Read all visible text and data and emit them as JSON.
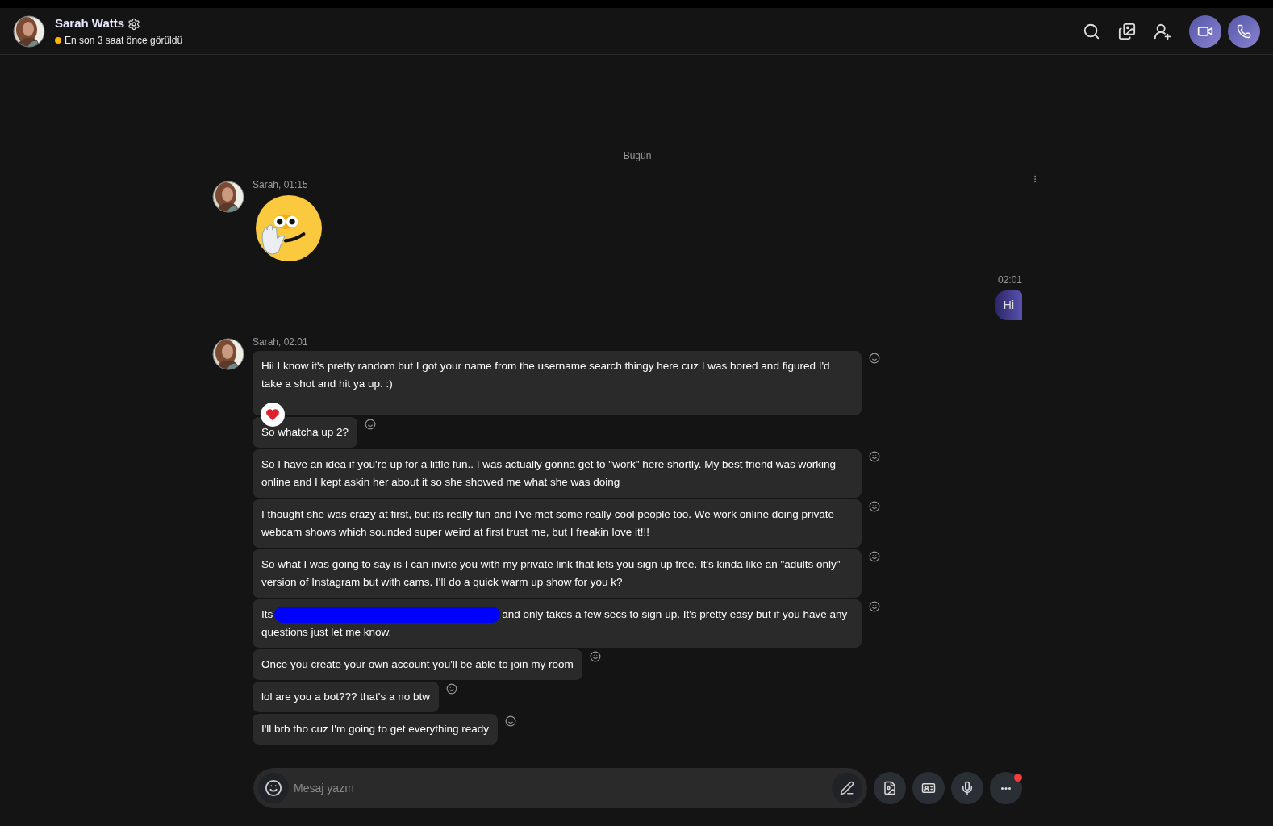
{
  "contact": {
    "name": "Sarah Watts",
    "status": "En son 3 saat önce görüldü"
  },
  "date_divider": "Bugün",
  "groups": [
    {
      "kind": "incoming",
      "header": "Sarah, 01:15",
      "items": [
        {
          "kind": "emoji"
        }
      ]
    },
    {
      "kind": "outgoing",
      "header": "02:01",
      "items": [
        {
          "kind": "text",
          "text": "Hi"
        }
      ]
    },
    {
      "kind": "incoming",
      "header": "Sarah, 02:01",
      "items": [
        {
          "kind": "text",
          "text": "Hii I know it's pretty random but I got your name from the username search thingy here cuz I was bored and figured I'd take a shot and hit ya up. :)",
          "heart": true
        },
        {
          "kind": "text",
          "text": "So whatcha up 2?",
          "heart": false
        },
        {
          "kind": "text",
          "text": "So I have an idea if you're up for a little fun.. I was actually gonna get to \"work\" here shortly. My best friend was working online and I kept askin her about it so she showed me what she was doing",
          "heart": false
        },
        {
          "kind": "text",
          "text": "I thought she was crazy at first, but its really fun and I've met some really cool people too. We work online doing private webcam shows which sounded super weird at first trust me, but I freakin love it!!!",
          "heart": false
        },
        {
          "kind": "text",
          "text": "So what I was going to say is I can invite you with my private link that lets you sign up free. It's kinda like an \"adults only\" version of Instagram but with cams. I'll do a quick warm up show for you k?",
          "heart": false
        },
        {
          "kind": "redacted",
          "before": "Its",
          "after": "and only takes a few secs to sign up. It's pretty easy but if you have any questions just let me know.",
          "heart": false
        },
        {
          "kind": "text",
          "text": "Once you create your own account you'll be able to join my room",
          "heart": false
        },
        {
          "kind": "text",
          "text": "lol are you a bot??? that's a no btw",
          "heart": false
        },
        {
          "kind": "text",
          "text": "I'll brb tho cuz I'm going to get everything ready",
          "heart": false
        }
      ]
    }
  ],
  "composer": {
    "placeholder": "Mesaj yazın",
    "more_badge": true
  }
}
